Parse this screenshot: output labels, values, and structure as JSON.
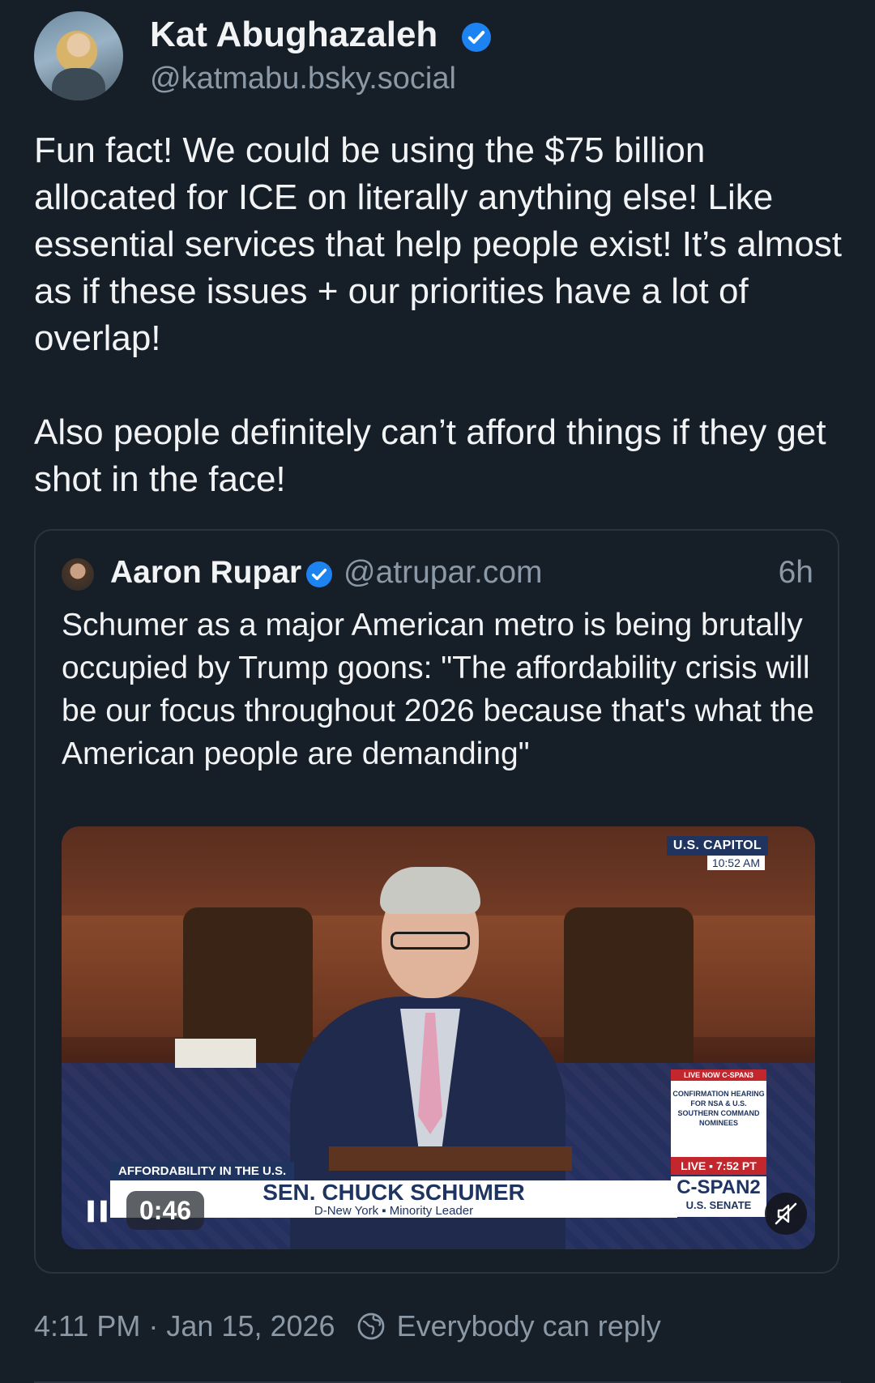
{
  "author": {
    "display_name": "Kat Abughazaleh",
    "handle": "@katmabu.bsky.social",
    "verified": true
  },
  "post": {
    "paragraphs": [
      "Fun fact! We could be using the $75 billion allocated for ICE on literally anything else! Like essential services that help people exist! It’s almost as if these issues + our priorities have a lot of overlap!",
      "Also people definitely can’t afford things if they get shot in the face!"
    ],
    "timestamp": "4:11 PM · Jan 15, 2026",
    "reply_setting": "Everybody can reply"
  },
  "quote": {
    "display_name": "Aaron Rupar",
    "handle": "@atrupar.com",
    "time_ago": "6h",
    "verified": true,
    "text": "Schumer as a major American metro is being brutally occupied by Trump goons: \"The affordability crisis will be our focus throughout 2026 because that's what the American people are demanding\""
  },
  "video": {
    "elapsed": "0:46",
    "overlay": {
      "capitol_tag": "U.S. CAPITOL",
      "clock": "10:52 AM",
      "lower_tag": "AFFORDABILITY IN THE U.S.",
      "lower_name": "SEN. CHUCK SCHUMER",
      "lower_sub": "D-New York ▪ Minority Leader",
      "panel_head": "LIVE NOW C-SPAN3",
      "panel_body": "CONFIRMATION HEARING FOR NSA & U.S. SOUTHERN COMMAND NOMINEES",
      "live_chip": "LIVE ▪ 7:52 PT",
      "network": "C-SPAN2",
      "network_sub": "U.S. SENATE"
    }
  },
  "colors": {
    "background": "#161e27",
    "text": "#f1f3f5",
    "muted": "#8b98a5",
    "verified": "#1d83f1",
    "border": "#2a3441"
  },
  "icons": {
    "verified": "verified-badge-icon",
    "pause": "pause-icon",
    "mute": "mute-icon",
    "globe": "globe-icon"
  }
}
